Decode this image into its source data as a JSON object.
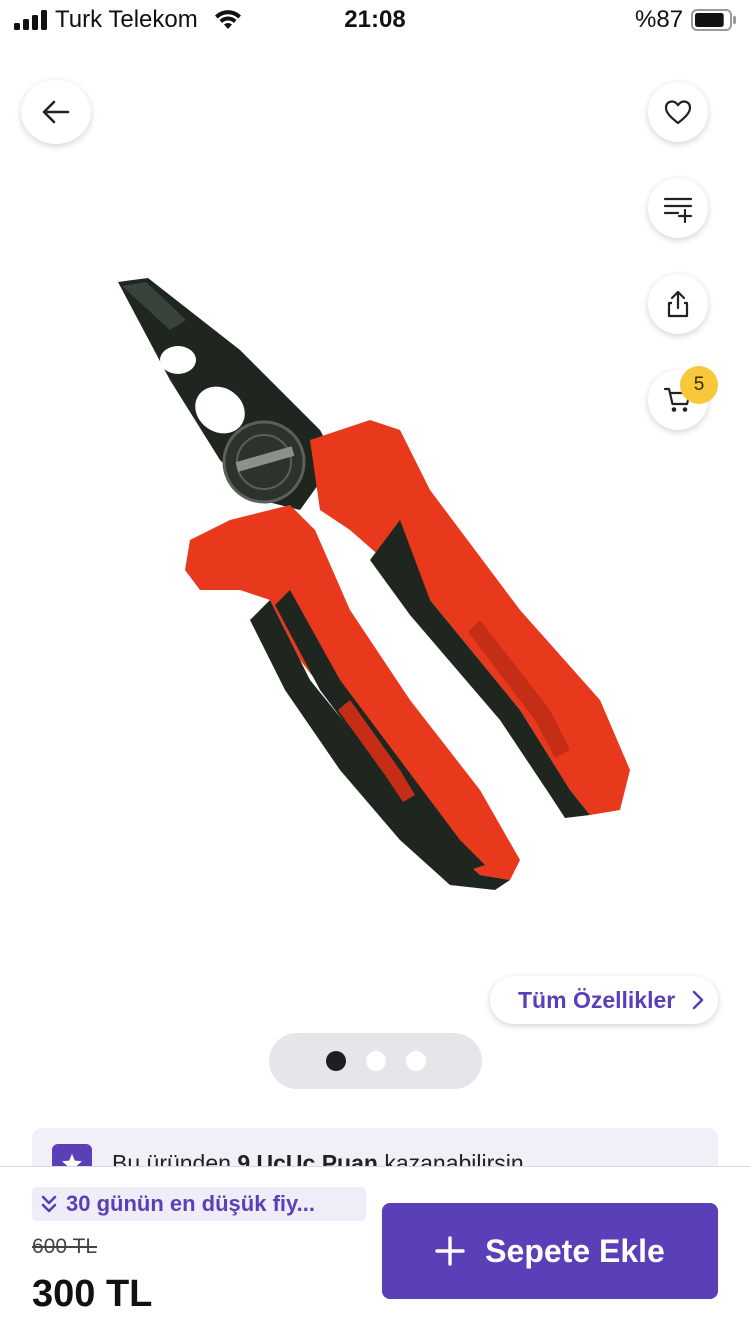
{
  "status_bar": {
    "carrier": "Turk Telekom",
    "time": "21:08",
    "battery": "%87",
    "battery_level": 0.87
  },
  "header": {
    "back_icon": "arrow-left-icon",
    "actions": [
      {
        "icon": "heart-icon",
        "label": "favorite"
      },
      {
        "icon": "list-add-icon",
        "label": "add-to-list"
      },
      {
        "icon": "share-icon",
        "label": "share"
      },
      {
        "icon": "cart-icon",
        "label": "cart"
      }
    ],
    "cart_count": "5"
  },
  "gallery": {
    "all_features_label": "Tüm Özellikler",
    "image_count": 3,
    "active_index": 0
  },
  "points_banner": {
    "prefix": "Bu üründen ",
    "points": "9 UcUc Puan",
    "suffix": " kazanabilirsin"
  },
  "purchase": {
    "lowest_price_label": "30 günün en düşük fiy...",
    "old_price": "600 TL",
    "price": "300 TL",
    "add_to_cart_label": "Sepete Ekle"
  },
  "colors": {
    "accent": "#5b3fb8",
    "badge": "#f6c83a",
    "pager_bg": "#e6e6ea"
  }
}
